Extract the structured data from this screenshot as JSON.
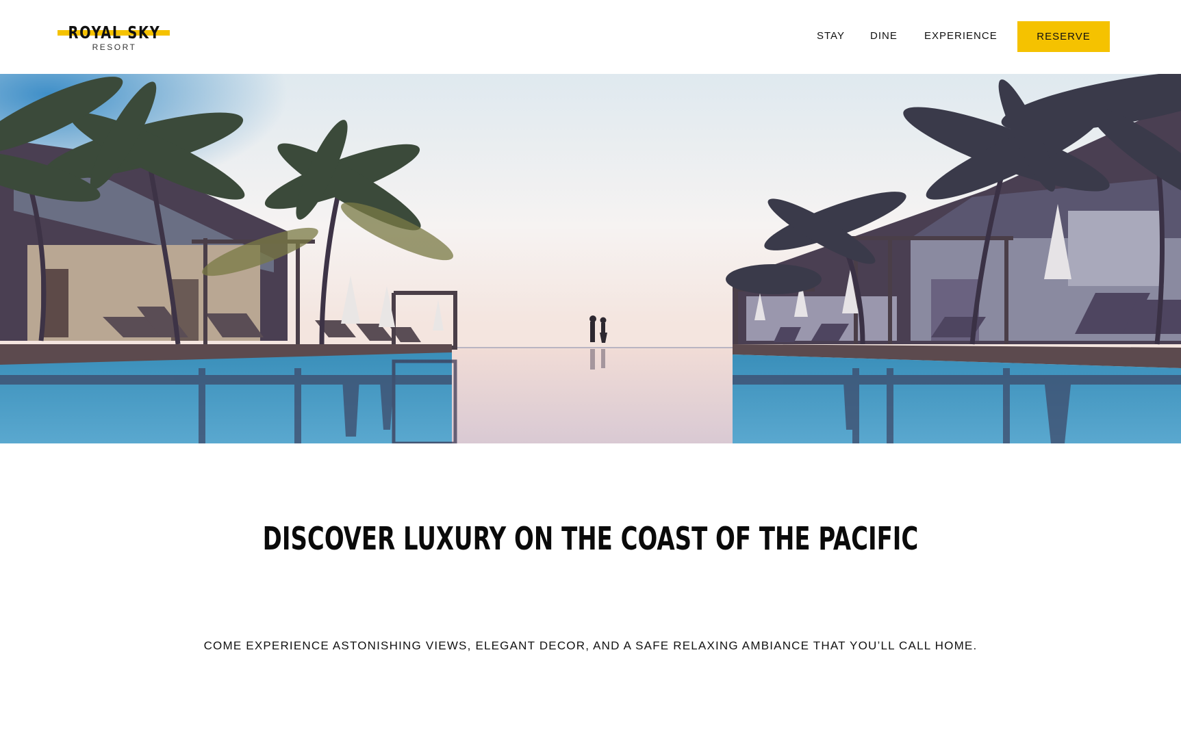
{
  "brand": {
    "name": "ROYAL SKY",
    "subtitle": "RESORT",
    "accent_color": "#f5c200"
  },
  "nav": {
    "items": [
      {
        "label": "STAY"
      },
      {
        "label": "DINE"
      },
      {
        "label": "EXPERIENCE"
      }
    ],
    "reserve_label": "RESERVE"
  },
  "hero": {
    "image_subject": "infinity-pool-with-palm-trees-and-couple-at-horizon"
  },
  "main": {
    "headline": "DISCOVER LUXURY ON THE COAST OF THE PACIFIC",
    "tagline": "COME EXPERIENCE ASTONISHING VIEWS, ELEGANT DECOR, AND A SAFE RELAXING AMBIANCE THAT YOU’LL CALL HOME."
  }
}
